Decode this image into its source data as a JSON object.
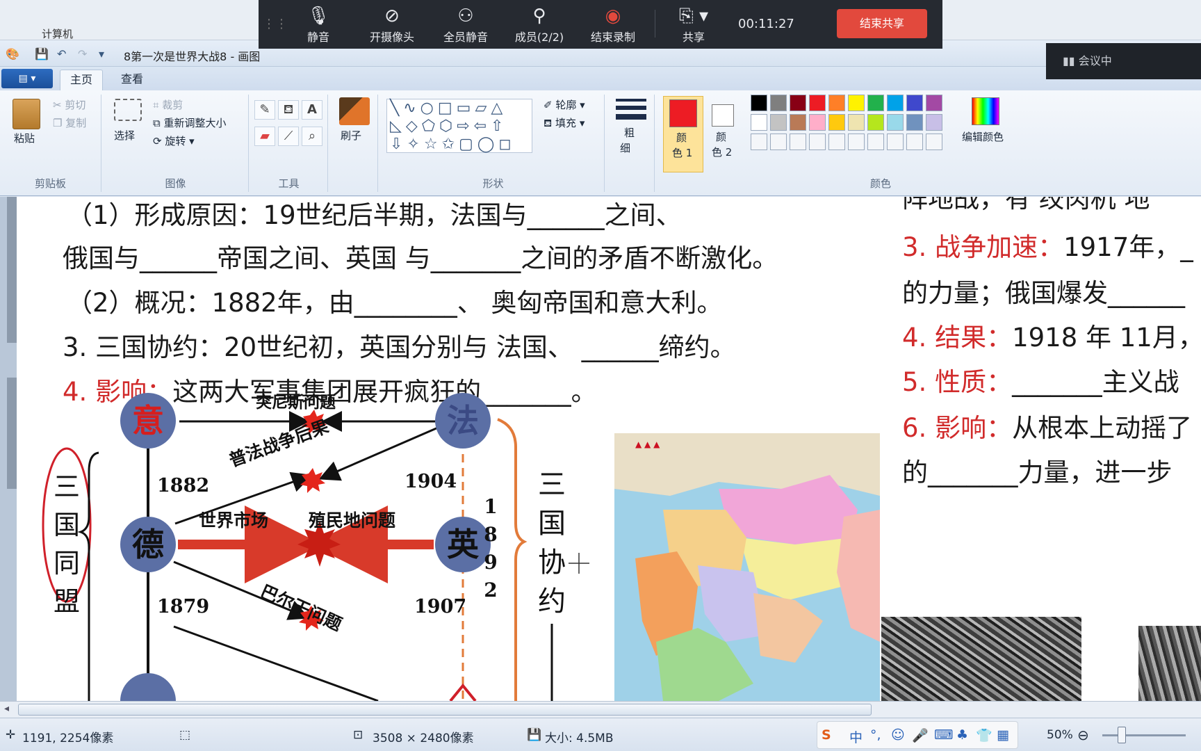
{
  "meeting": {
    "mute": "静音",
    "camera": "开摄像头",
    "mute_all": "全员静音",
    "members": "成员(2/2)",
    "end_record": "结束录制",
    "share": "共享",
    "timer": "00:11:27",
    "end_share": "结束共享",
    "status": "会议中"
  },
  "window": {
    "title": "8第一次是世界大战8 - 画图",
    "bg_text": "计算机"
  },
  "tabs": [
    "主页",
    "查看"
  ],
  "ribbon": {
    "clipboard": {
      "paste": "粘贴",
      "cut": "剪切",
      "copy": "复制",
      "label": "剪贴板"
    },
    "image": {
      "select": "选择",
      "crop": "裁剪",
      "resize": "重新调整大小",
      "rotate": "旋转",
      "label": "图像"
    },
    "tools": {
      "label": "工具"
    },
    "brush": {
      "label": "刷子"
    },
    "shapes": {
      "outline": "轮廓",
      "fill": "填充",
      "label": "形状"
    },
    "size": {
      "label1": "粗",
      "label2": "细"
    },
    "color1": {
      "l1": "颜",
      "l2": "色 1"
    },
    "color2": {
      "l1": "颜",
      "l2": "色 2"
    },
    "colors": {
      "label": "颜色",
      "edit": "编辑颜色"
    },
    "palette_row1": [
      "#000000",
      "#7f7f7f",
      "#880015",
      "#ed1c24",
      "#ff7f27",
      "#fff200",
      "#22b14c",
      "#00a2e8",
      "#3f48cc",
      "#a349a4"
    ],
    "palette_row2": [
      "#ffffff",
      "#c3c3c3",
      "#b97a57",
      "#ffaec9",
      "#ffc90e",
      "#efe4b0",
      "#b5e61d",
      "#99d9ea",
      "#7092be",
      "#c8bfe7"
    ],
    "color1_value": "#ed1c24",
    "color2_value": "#ffffff"
  },
  "doc": {
    "left": {
      "l1": "（1）形成原因：19世纪后半期，法国与______之间、",
      "l2": "俄国与______帝国之间、英国 与_______之间的矛盾不断激化。",
      "l3": "（2）概况：1882年，由________、 奥匈帝国和意大利。",
      "l4": "3. 三国协约：20世纪初，英国分别与 法国、 ______缔约。",
      "l5_red": "4. 影响：",
      "l5": "这两大军事集团展开疯狂的_______。"
    },
    "right": {
      "r0": "阵地战，有 绞肉机  地",
      "r1_red": "3. 战争加速：",
      "r1": "1917年，_",
      "r2": "的力量；俄国爆发______",
      "r3_red": "4. 结果：",
      "r3": "1918 年 11月，",
      "r4_red": "5. 性质：",
      "r4": "_______主义战",
      "r5_red": "6. 影响：",
      "r5": "从根本上动摇了",
      "r6": "的_______力量，进一步"
    },
    "diagram": {
      "italy": "意",
      "france": "法",
      "germany": "德",
      "britain": "英",
      "tunisia": "突尼斯问题",
      "franco_prussian": "普法战争后果",
      "world_market": "世界市场",
      "colonial": "殖民地问题",
      "balkan": "巴尔干问题",
      "y1882": "1882",
      "y1904": "1904",
      "y1879": "1879",
      "y1907": "1907",
      "y1892": [
        "1",
        "8",
        "9",
        "2"
      ],
      "triple_alliance": [
        "三",
        "国",
        "同",
        "盟"
      ],
      "triple_entente": [
        "三",
        "国",
        "协",
        "约"
      ]
    }
  },
  "status": {
    "coords": "1191, 2254像素",
    "dimensions": "3508 × 2480像素",
    "size": "大小: 4.5MB",
    "zoom": "50%",
    "zoom_level": 0.5,
    "ime_lang": "中"
  }
}
